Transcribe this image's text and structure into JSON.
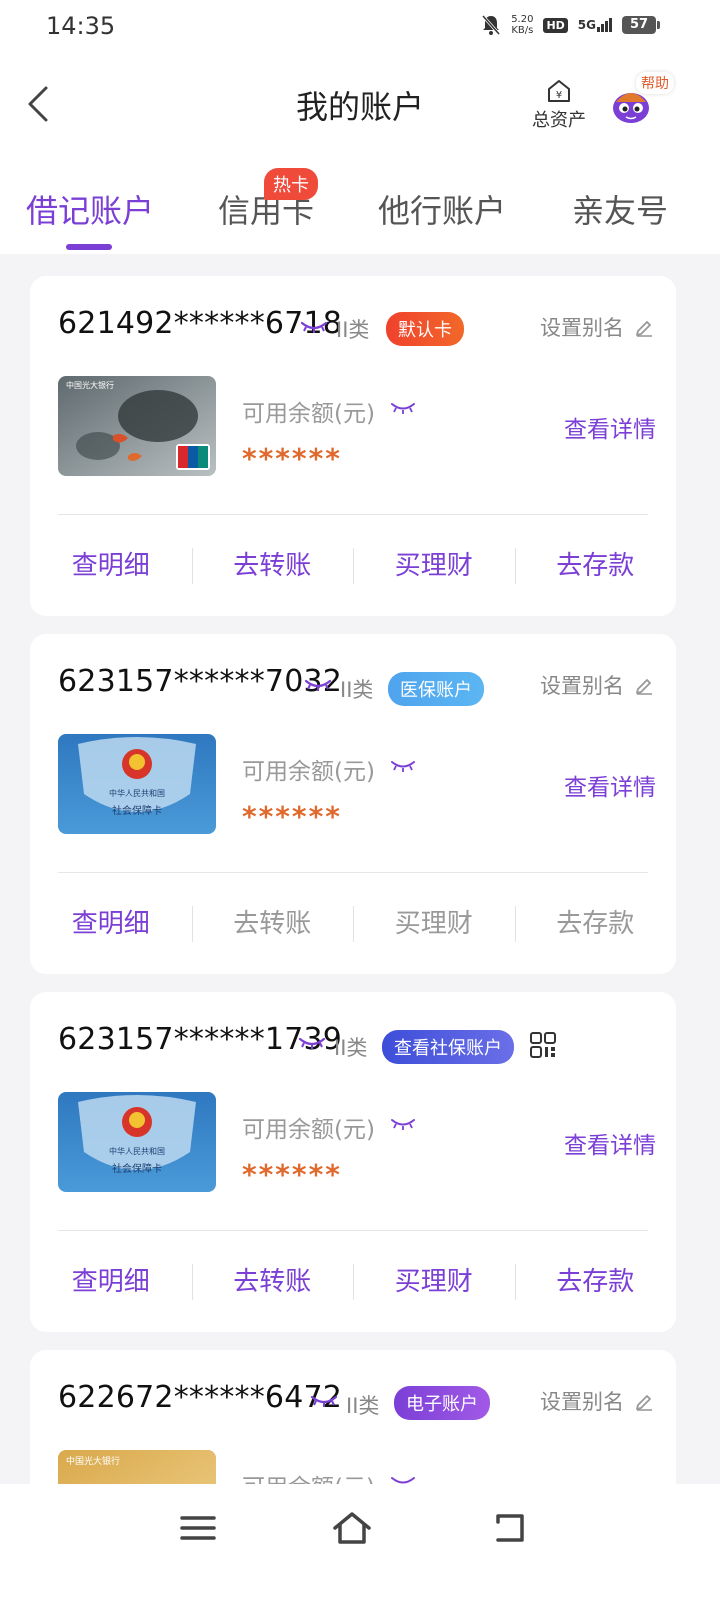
{
  "status_bar": {
    "time": "14:35",
    "net_speed_top": "5.20",
    "net_speed_bottom": "KB/s",
    "hd": "HD",
    "signal": "5G",
    "battery": "57"
  },
  "header": {
    "title": "我的账户",
    "assets_label": "总资产",
    "help_label": "帮助"
  },
  "tabs": [
    {
      "label": "借记账户"
    },
    {
      "label": "信用卡"
    },
    {
      "label": "他行账户"
    },
    {
      "label": "亲友号"
    }
  ],
  "hot_badge": "热卡",
  "common": {
    "balance_label": "可用余额(元)",
    "balance_mask": "******",
    "detail_label": "查看详情",
    "alias_label": "设置别名",
    "class_label": "II类"
  },
  "cards": [
    {
      "number": "621492******6718",
      "tag": "默认卡",
      "actions": [
        "查明细",
        "去转账",
        "买理财",
        "去存款"
      ]
    },
    {
      "number": "623157******7032",
      "tag": "医保账户",
      "actions": [
        "查明细",
        "去转账",
        "买理财",
        "去存款"
      ]
    },
    {
      "number": "623157******1739",
      "tag": "查看社保账户",
      "actions": [
        "查明细",
        "去转账",
        "买理财",
        "去存款"
      ]
    },
    {
      "number": "622672******6472",
      "tag": "电子账户"
    }
  ],
  "card_images": {
    "everbright_bank": "中国光大银行",
    "social_country": "中华人民共和国",
    "social_card": "社会保障卡",
    "unionpay": "UnionPay 银联"
  },
  "colors": {
    "accent": "#7b3fd6",
    "balance": "#e06a2d",
    "tag_default": "#f0412d",
    "tag_medical": "#4fa4ee",
    "tag_social": "#3d4ed8",
    "tag_electronic": "#7b3fd6"
  },
  "icons": [
    "back-arrow-icon",
    "home-yuan-icon",
    "eye-closed-icon",
    "edit-pencil-icon",
    "qr-code-icon",
    "menu-icon",
    "home-icon",
    "back-icon"
  ]
}
